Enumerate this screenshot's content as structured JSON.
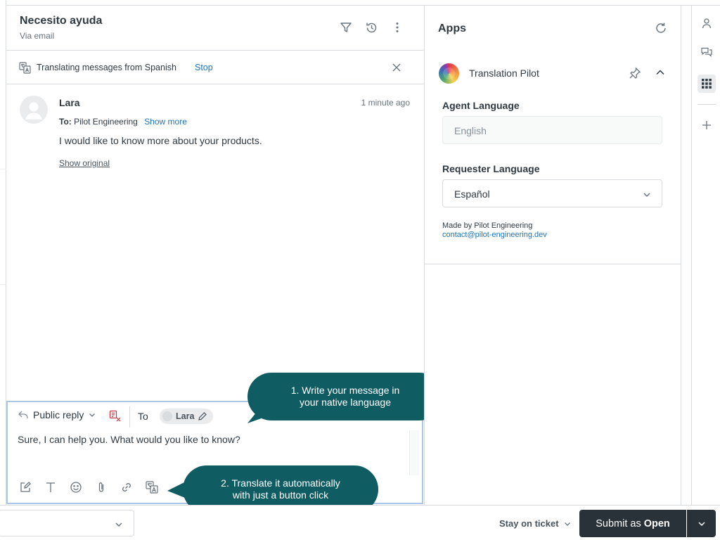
{
  "ticket": {
    "title": "Necesito ayuda",
    "channel": "Via email"
  },
  "translation_bar": {
    "text": "Translating messages from Spanish",
    "stop_label": "Stop"
  },
  "message": {
    "author": "Lara",
    "time": "1 minute ago",
    "to_label": "To:",
    "to_value": "Pilot Engineering",
    "show_more": "Show more",
    "body": "I would like to know more about your products.",
    "show_original": "Show original"
  },
  "composer": {
    "reply_type": "Public reply",
    "to_label": "To",
    "recipient": "Lara",
    "text": "Sure, I can help you. What would you like to know?"
  },
  "bottom_bar": {
    "stay_on": "Stay on ticket",
    "submit_prefix": "Submit as",
    "submit_status": "Open"
  },
  "apps": {
    "title": "Apps",
    "app_name": "Translation Pilot",
    "agent_language_label": "Agent Language",
    "agent_language_value": "English",
    "requester_language_label": "Requester Language",
    "requester_language_value": "Español",
    "made_by": "Made by Pilot Engineering",
    "contact": "contact@pilot-engineering.dev"
  },
  "callouts": {
    "one_line1": "1. Write your message in",
    "one_line2": "your native language",
    "two_line1": "2. Translate it automatically",
    "two_line2": "with just a button click"
  },
  "colors": {
    "link": "#1f73b7",
    "callout": "#0f5c63",
    "submit": "#293239",
    "composer_border": "#acc6e8"
  }
}
